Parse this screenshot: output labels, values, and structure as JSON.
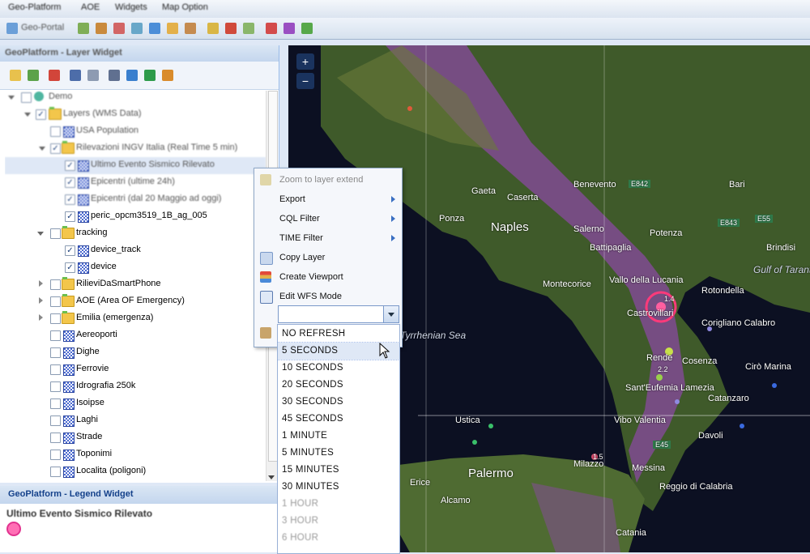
{
  "menubar": {
    "items": [
      "Geo-Platform",
      "AOE",
      "Widgets",
      "Map Option"
    ]
  },
  "toolbar": {
    "portal_label": "Geo-Portal"
  },
  "layer_widget": {
    "title": "GeoPlatform - Layer Widget",
    "tree": [
      {
        "label": "Demo",
        "blur": true
      },
      {
        "label": "Layers (WMS Data)",
        "blur": true
      },
      {
        "label": "USA Population",
        "blur": true
      },
      {
        "label": "Rilevazioni INGV Italia (Real Time 5 min)",
        "blur": true
      },
      {
        "label": "Ultimo Evento Sismico Rilevato",
        "blur": true
      },
      {
        "label": "Epicentri (ultime 24h)",
        "blur": true
      },
      {
        "label": "Epicentri (dal 20 Maggio ad oggi)",
        "blur": true
      },
      {
        "label": "peric_opcm3519_1B_ag_005"
      },
      {
        "label": "tracking"
      },
      {
        "label": "device_track"
      },
      {
        "label": "device"
      },
      {
        "label": "RilieviDaSmartPhone"
      },
      {
        "label": "AOE (Area OF Emergency)"
      },
      {
        "label": "Emilia (emergenza)"
      },
      {
        "label": "Aereoporti"
      },
      {
        "label": "Dighe"
      },
      {
        "label": "Ferrovie"
      },
      {
        "label": "Idrografia 250k"
      },
      {
        "label": "Isoipse"
      },
      {
        "label": "Laghi"
      },
      {
        "label": "Strade"
      },
      {
        "label": "Toponimi"
      },
      {
        "label": "Localita (poligoni)"
      }
    ]
  },
  "legend_widget": {
    "title": "GeoPlatform - Legend Widget",
    "layer_title": "Ultimo Evento Sismico Rilevato"
  },
  "context_menu": {
    "items": [
      {
        "label": "Zoom to layer extend",
        "disabled": true
      },
      {
        "label": "Export",
        "submenu": true
      },
      {
        "label": "CQL Filter",
        "submenu": true
      },
      {
        "label": "TIME Filter",
        "submenu": true
      },
      {
        "label": "Copy Layer"
      },
      {
        "label": "Create Viewport"
      },
      {
        "label": "Edit WFS Mode"
      }
    ],
    "refresh_value": ""
  },
  "refresh_options": [
    "NO REFRESH",
    "5 SECONDS",
    "10 SECONDS",
    "20 SECONDS",
    "30 SECONDS",
    "45 SECONDS",
    "1 MINUTE",
    "5 MINUTES",
    "15 MINUTES",
    "30 MINUTES",
    "1 HOUR",
    "3 HOUR",
    "6 HOUR"
  ],
  "refresh_highlighted": "5 SECONDS",
  "map": {
    "zoom_in": "+",
    "zoom_out": "−",
    "labels": {
      "naples": "Naples",
      "palermo": "Palermo",
      "tyrrhenian": "Tyrrhenian Sea",
      "caserta": "Caserta",
      "gaeta": "Gaeta",
      "ponza": "Ponza",
      "salerno": "Salerno",
      "battipaglia": "Battipaglia",
      "benevento": "Benevento",
      "potenza": "Potenza",
      "bari": "Bari",
      "brindisi": "Brindisi",
      "taranto": "Gulf of Taranto",
      "castrovillari": "Castrovillari",
      "corigliano": "Corigliano Calabro",
      "cosenza": "Cosenza",
      "rende": "Rende",
      "lamezia": "Sant'Eufemia Lamezia",
      "catanzaro": "Catanzaro",
      "vibo": "Vibo Valentia",
      "messina": "Messina",
      "reggio": "Reggio di Calabria",
      "rotondella": "Rotondella",
      "ciro": "Cirò Marina",
      "montecorice": "Montecorice",
      "ustica": "Ustica",
      "vallo": "Vallo della Lucania",
      "catania": "Catania",
      "erice": "Erice",
      "alcamo": "Alcamo",
      "milazzo": "Milazzo",
      "davoli": "Davoli"
    },
    "road_signs": [
      "E842",
      "E843",
      "E55",
      "E45"
    ],
    "magnitudes": [
      "1.4",
      "2.2",
      "1.5"
    ]
  }
}
